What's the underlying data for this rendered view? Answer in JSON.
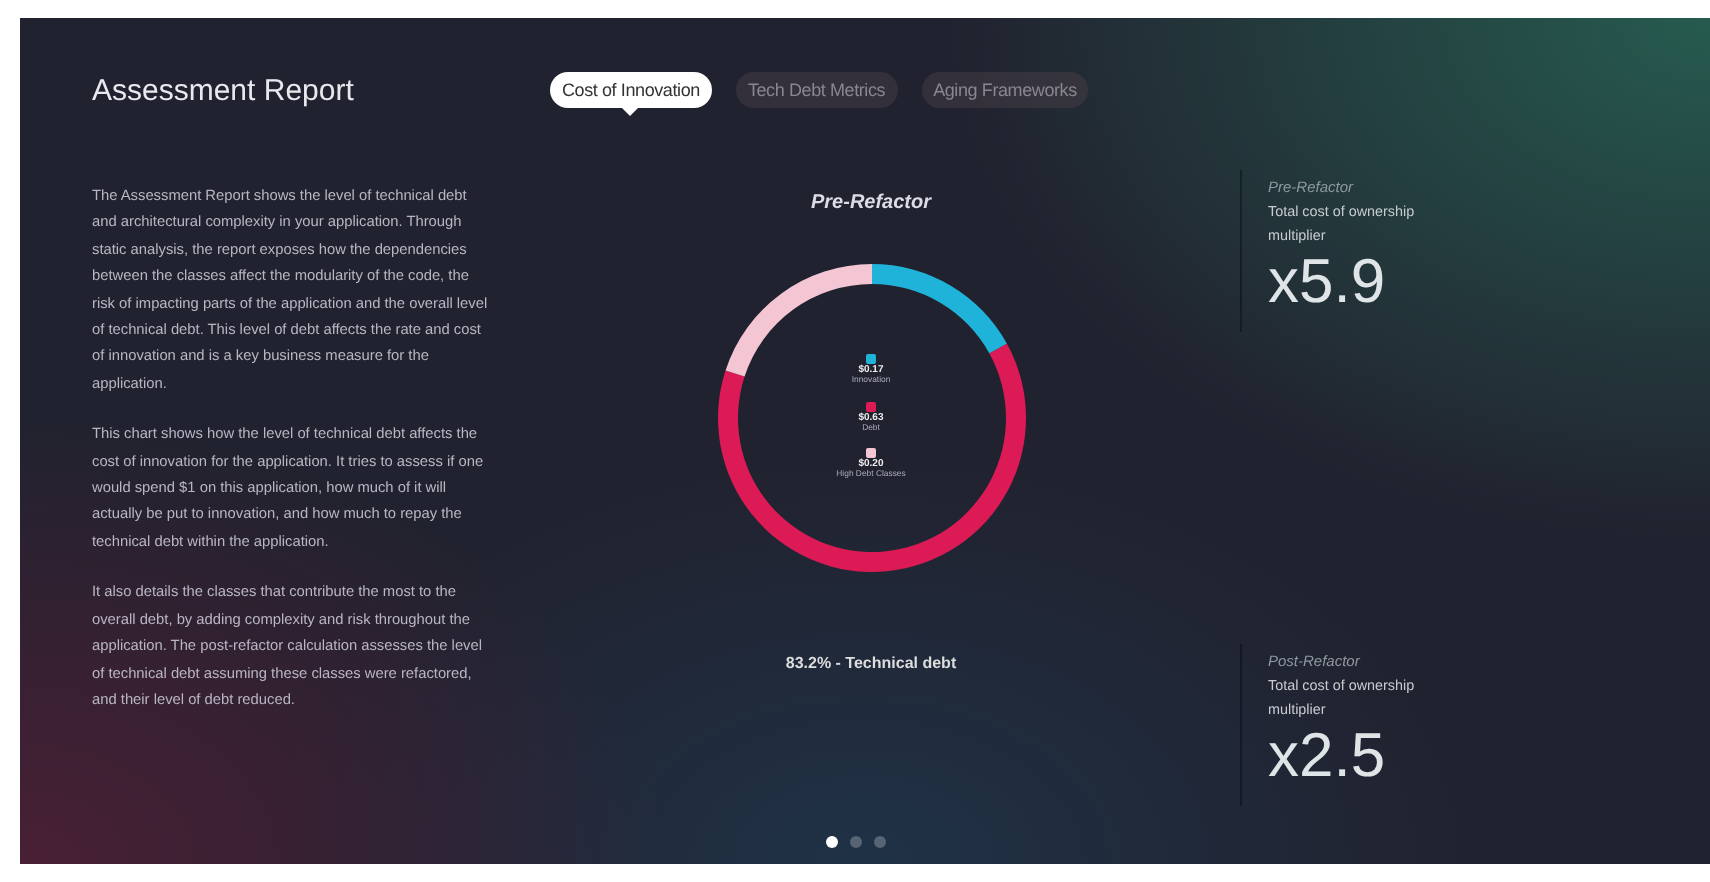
{
  "title": "Assessment Report",
  "tabs": [
    {
      "label": "Cost of Innovation",
      "selected": true
    },
    {
      "label": "Tech Debt Metrics",
      "selected": false
    },
    {
      "label": "Aging Frameworks",
      "selected": false
    }
  ],
  "description": [
    "The Assessment Report shows the level of technical debt and architectural complexity in your application. Through static analysis, the report exposes how the dependencies between the classes affect the modularity of the code, the risk of impacting parts of the application and the overall level of technical debt. This level of debt affects the rate and cost of innovation and is a key business measure for the application.",
    "This chart shows how the level of technical debt affects the cost of innovation for the application. It tries to assess if one would spend $1 on this application, how much of it will actually be put to innovation, and how much to repay the technical debt within the application.",
    "It also details the classes that contribute the most to the overall debt, by adding complexity and risk throughout the application. The post-refactor calculation assesses the level of technical debt assuming these classes were refactored, and their level of debt reduced."
  ],
  "chart": {
    "heading": "Pre-Refactor",
    "chart_data": {
      "type": "donut",
      "categories": [
        "Innovation",
        "Debt",
        "High Debt Classes"
      ],
      "values": [
        0.17,
        0.63,
        0.2
      ],
      "legend": "center"
    },
    "legend": [
      {
        "value": "$0.17",
        "color": "#1fb3d9"
      },
      {
        "value": "$0.63",
        "color": "#dc1a55"
      },
      {
        "value": "$0.20",
        "color": "#f4c6d4"
      }
    ],
    "caption": "83.2% - Technical debt"
  },
  "stats": [
    {
      "label": "Pre-Refactor",
      "description": "Total cost of ownership multiplier",
      "value": "x5.9"
    },
    {
      "label": "Post-Refactor",
      "description": "Total cost of ownership multiplier",
      "value": "x2.5"
    }
  ],
  "pages": [
    {
      "selected": true
    },
    {
      "selected": false
    },
    {
      "selected": false
    }
  ]
}
